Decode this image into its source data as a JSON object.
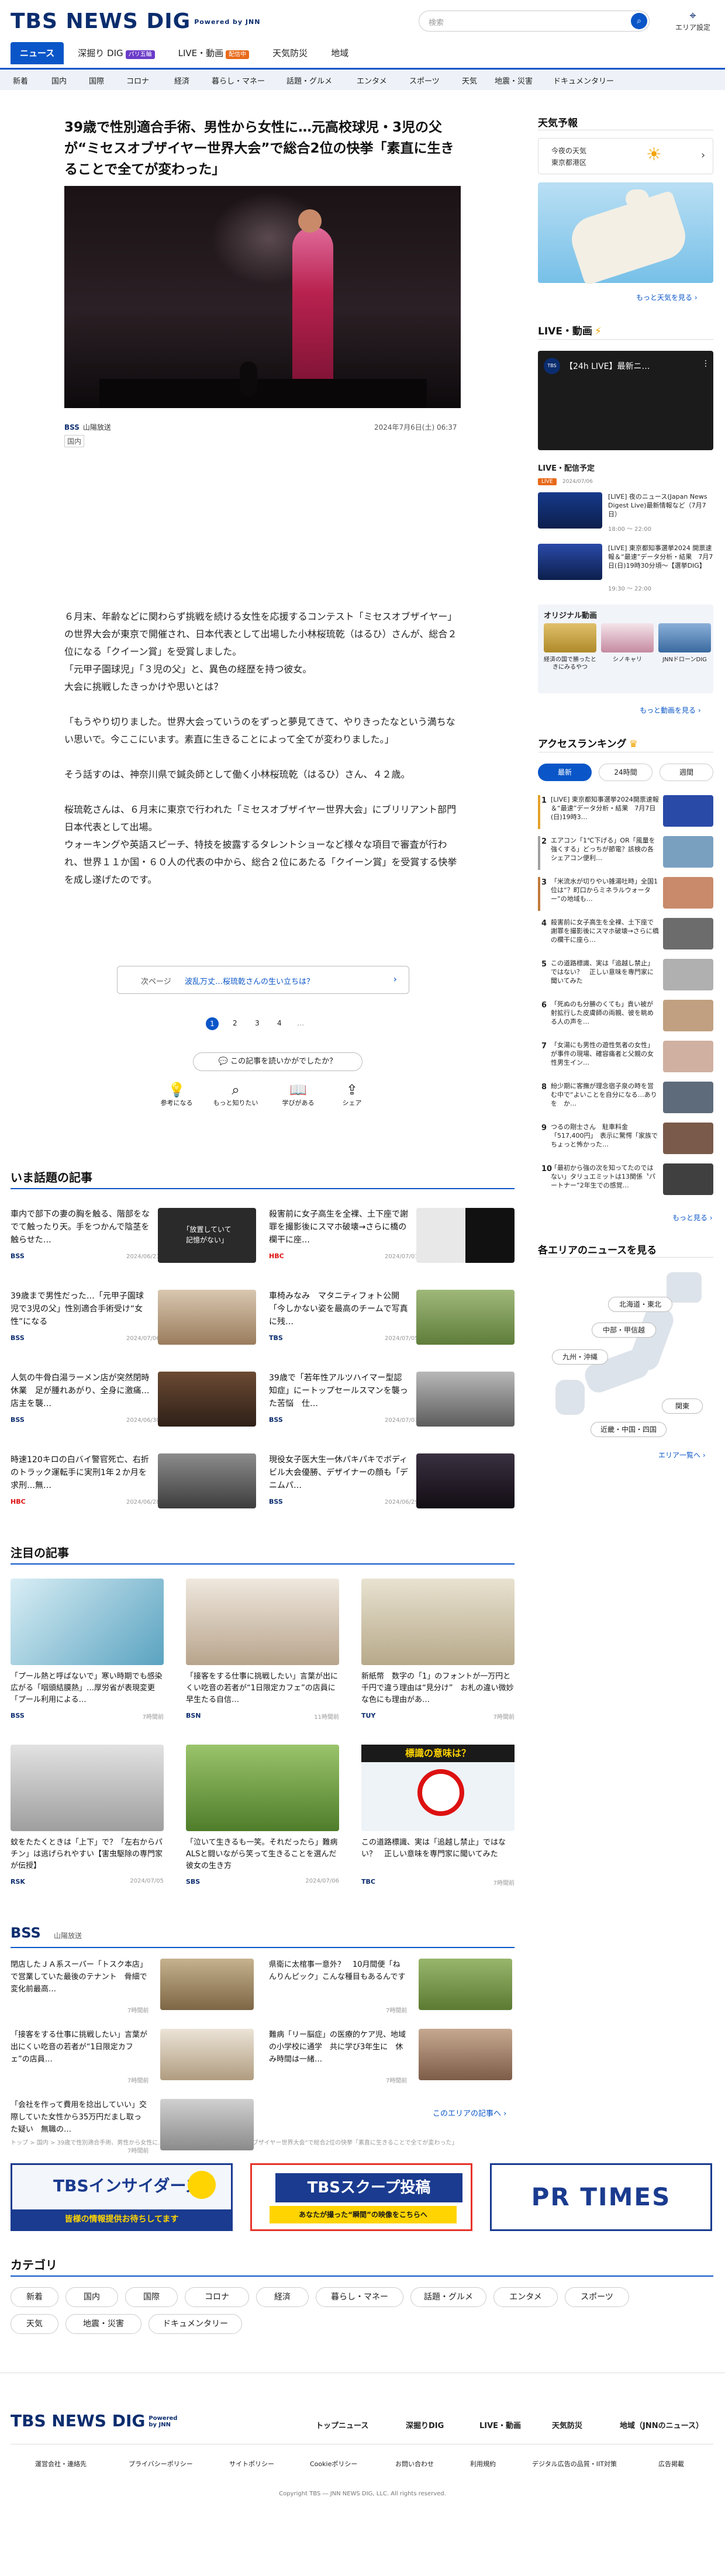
{
  "header": {
    "logo": "TBS NEWS DIG",
    "powered": "Powered by JNN",
    "search_placeholder": "検索",
    "area_label": "エリア設定"
  },
  "gnav": [
    {
      "label": "ニュース"
    },
    {
      "label": "深掘り DIG",
      "badge": "パリ五輪"
    },
    {
      "label": "LIVE・動画",
      "badge": "配信中"
    },
    {
      "label": "天気防災"
    },
    {
      "label": "地域"
    }
  ],
  "subnav": [
    "新着",
    "国内",
    "国際",
    "コロナ",
    "経済",
    "暮らし・マネー",
    "話題・グルメ",
    "エンタメ",
    "スポーツ",
    "天気",
    "地震・災害",
    "ドキュメンタリー"
  ],
  "article": {
    "title": "39歳で性別適合手術、男性から女性に…元高校球児・3児の父が“ミセスオブザイヤー世界大会”で総合2位の快挙「素直に生きることで全てが変わった」",
    "source": "山陽放送",
    "date": "2024年7月6日(土) 06:37",
    "category": "国内",
    "paragraphs": [
      "６月末、年齢などに関わらず挑戦を続ける女性を応援するコンテスト「ミセスオブザイヤー」の世界大会が東京で開催され、日本代表として出場した小林桜琉乾（はるひ）さんが、総合２位になる「クイーン賞」を受賞しました。",
      "「元甲子園球児」「３児の父」と、異色の経歴を持つ彼女。",
      "大会に挑戦したきっかけや思いとは？",
      "「もうやり切りました。世界大会っていうのをずっと夢見てきて、やりきったなという満ちない思いで。今ここにいます。素直に生きることによって全てが変わりました。」",
      "そう話すのは、神奈川県で鍼灸師として働く小林桜琉乾（はるひ）さん、４２歳。",
      "桜琉乾さんは、６月末に東京で行われた「ミセスオブザイヤー世界大会」にブリリアント部門日本代表として出場。",
      "ウォーキングや英語スピーチ、特技を披露するタレントショーなど様々な項目で審査が行われ、世界１１か国・６０人の代表の中から、総合２位にあたる「クイーン賞」を受賞する快挙を成し遂げたのです。"
    ],
    "next_page_label": "次ページ",
    "next_page_text": "波乱万丈…桜琉乾さんの生い立ちは？",
    "pages": [
      "1",
      "2",
      "3",
      "4",
      "…"
    ],
    "feedback_q": "この記事を読いかがでしたか？",
    "reactions": [
      "参考になる",
      "もっと知りたい",
      "学びがある",
      "シェア"
    ]
  },
  "trending": {
    "title": "いま話題の記事",
    "items": [
      {
        "text": "車内で部下の妻の胸を触る、階部をなでて触ったり天。手をつかんで陰茎を触らせた…",
        "src": "BSS",
        "date": "2024/06/21",
        "thumb_text": "「放置していて\n記憶がない」"
      },
      {
        "text": "殺害前に女子高生を全裸、土下座で謝罪を撮影後にスマホ破壊→さらに橋の欄干に座…",
        "src": "HBC",
        "date": "2024/07/01",
        "thumb_text": ""
      },
      {
        "text": "39歳まで男性だった…「元甲子園球児で3児の父」性別適合手術受け“女性”になる",
        "src": "BSS",
        "date": "2024/07/06",
        "thumb_text": ""
      },
      {
        "text": "車椅みなみ　マタニティフォト公開　「今しかない姿を最高のチームで写真に残…",
        "src": "TBS",
        "date": "2024/07/05",
        "thumb_text": ""
      },
      {
        "text": "人気の牛骨白湯ラーメン店が突然閉時休業　足が腫れあがり、全身に激痛…店主を襲…",
        "src": "BSS",
        "date": "2024/06/30",
        "thumb_text": ""
      },
      {
        "text": "39歳で「若年性アルツハイマー型認知症」にートップセールスマンを襲った苦悩　仕…",
        "src": "BSS",
        "date": "2024/07/03",
        "thumb_text": ""
      },
      {
        "text": "時速120キロの白バイ警官死亡、右折のトラック運転手に実刑1年２か月を求刑…無…",
        "src": "HBC",
        "date": "2024/06/28",
        "thumb_text": ""
      },
      {
        "text": "現役女子医大生一休パキパキでボディビル大会優勝、デザイナーの顔も「デニムパ…",
        "src": "BSS",
        "date": "2024/06/29",
        "thumb_text": ""
      }
    ]
  },
  "featured": {
    "title": "注目の記事",
    "items": [
      {
        "text": "「プール熱と呼ばないで」寒い時期でも感染広がる「咽頭結膜熱」…厚労省が表現変更「プール利用による…",
        "src": "BSS",
        "date": "7時間前"
      },
      {
        "text": "「接客をする仕事に挑戦したい」言葉が出にくい吃音の若者が“1日限定カフェ”の店員に　早生たる自信…",
        "src": "BSN",
        "date": "11時間前"
      },
      {
        "text": "新紙幣　数字の「1」のフォントが一万円と千円で違う理由は“見分け”　お札の違い微妙な色にも理由があ…",
        "src": "TUY",
        "date": "7時間前"
      },
      {
        "text": "蚊をたたくときは「上下」で？「左右からパチン」は逃げられやすい【害虫駆除の専門家が伝授】",
        "src": "RSK",
        "date": "2024/07/05"
      },
      {
        "text": "「泣いて生きるも一笑。それだったら」難病ALSと闘いながら笑って生きることを選んだ彼女の生き方",
        "src": "SBS",
        "date": "2024/07/06"
      },
      {
        "text": "この道路標識、実は「追越し禁止」ではない？　正しい意味を専門家に聞いてみた",
        "src": "TBC",
        "date": "7時間前"
      }
    ],
    "sign_title": "標識の意味は？"
  },
  "local": {
    "station": "BSS",
    "station_name": "山陽放送",
    "items": [
      {
        "text": "閉店したＪＡ系スーパー「トスク本店」で営業していた最後のテナント　骨細で変化前最高…",
        "date": "7時間前"
      },
      {
        "text": "県衛に太棺事一意外？　10月間便「ねんりんピック」こんな種目もあるんです",
        "date": "7時間前"
      },
      {
        "text": "「接客をする仕事に挑戦したい」言葉が出にくい吃音の若者が“1日限定カフェ”の店員…",
        "date": "7時間前"
      },
      {
        "text": "「会社を作って費用を捻出していい」交際していた女性から35万円だまし取った疑い　無職の…",
        "date": "7時間前"
      },
      {
        "text": "難病「リー脳症」の医療的ケア児、地域の小学校に通学　共に学び3年生に　休み時間は一緒…",
        "date": "7時間前"
      },
      {
        "text": "",
        "date": ""
      }
    ],
    "more": "このエリアの記事へ"
  },
  "breadcrumb": "トップ > 国内 > 39歳で性別適合手術、男性から女性に…元高校球児・3児の父が“ミセスオブザイヤー世界大会”で総合2位の快挙「素直に生きることで全てが変わった」",
  "banners": [
    {
      "title": "TBSインサイダーズ",
      "sub": "皆様の情報提供お待ちしてます"
    },
    {
      "title": "TBSスクープ投稿",
      "sub": "あなたが撮った“瞬間”の映像をこちらへ"
    },
    {
      "title": "PR TIMES",
      "sub": ""
    }
  ],
  "category": {
    "title": "カテゴリ",
    "items": [
      "新着",
      "国内",
      "国際",
      "コロナ",
      "経済",
      "暮らし・マネー",
      "話題・グルメ",
      "エンタメ",
      "スポーツ",
      "天気",
      "地震・災害",
      "ドキュメンタリー"
    ]
  },
  "sidebar": {
    "weather_title": "天気予報",
    "weather_today": "今夜の天気",
    "weather_place": "東京都港区",
    "weather_more": "もっと天気を見る",
    "live_title": "LIVE・動画",
    "live_video_title": "【24h LIVE】最新ニ…",
    "live_sched_title": "LIVE・配信予定",
    "live_items": [
      {
        "badge": "LIVE",
        "date": "2024/07/06",
        "text": "[LIVE] 夜のニュース(Japan News Digest Live)最新情報など（7月7日）",
        "time": "18:00 〜 22:00"
      },
      {
        "badge": "",
        "date": "",
        "text": "[LIVE] 東京都知事選挙2024 開票速報＆“最速”データ分析・結果　7月7日(日)19時30分頃〜【選挙DIG】",
        "time": "19:30 〜 22:00"
      }
    ],
    "orig_title": "オリジナル動画",
    "orig_items": [
      "経済の国で勝ったときにみるやつ",
      "シノキャリ",
      "JNNドローンDIG"
    ],
    "orig_more": "もっと動画を見る",
    "rank_title": "アクセスランキング",
    "rank_tabs": [
      "最新",
      "24時間",
      "週間"
    ],
    "rank_items": [
      "[LIVE] 東京都知事選挙2024開票速報＆“最速”データ分析・結果　7月7日(日)19時3…",
      "エアコン「1℃下げる」OR「風量を強くする」どっちが節電？該検の各シェアコン便利…",
      "「米流水が切りやい雑湯吐時」全国1位は“？町口からミネラルウォーター”の地域も…",
      "殺害前に女子高生を全裸、土下座で謝罪を撮影後にスマホ破壊→さらに橋の欄干に座ら…",
      "この道路標識、実は「追越し禁止」ではない？　正しい意味を専門家に聞いてみた",
      "「死ぬのも分勝のくても」貴い被が射拡行した皮膚師の両親、彼を眺める人の声を…",
      "「女湯にも男性の遊性気者の女性」が事件の現場、確容痛者と父親の女性男生イン…",
      "紛少期に客撫が理念宿子泉の時を営む中で“よいことを自分になる…ありを　か…",
      "つるの剛士さん　駐車料金「517,400円」　表示に驚愕「家族でちょっと怖かった…",
      "「最初から強の次を知ってたのではない」タリュエミットは13関係〝パートナー”2年生での感覚…"
    ],
    "rank_more": "もっと見る",
    "area_title": "各エリアのニュースを見る",
    "areas": [
      "北海道・東北",
      "中部・甲信越",
      "九州・沖縄",
      "関東",
      "近畿・中国・四国"
    ],
    "area_more": "エリア一覧へ"
  },
  "footer": {
    "logo": "TBS NEWS DIG",
    "powered": "Powered by JNN",
    "nav": [
      "トップニュース",
      "深掘りDIG",
      "LIVE・動画",
      "天気防災",
      "地域（JNNのニュース）"
    ],
    "links": [
      "運営会社・連絡先",
      "プライバシーポリシー",
      "サイトポリシー",
      "Cookieポリシー",
      "お問い合わせ",
      "利用規約",
      "デジタル広告の品質・IIT対策",
      "広告掲載"
    ],
    "copyright": "Copyright TBS ― JNN NEWS DIG, LLC. All rights reserved."
  },
  "colors": {
    "accent": "#0a56c8",
    "brand": "#0b2d6e",
    "live": "#e86a1a"
  }
}
